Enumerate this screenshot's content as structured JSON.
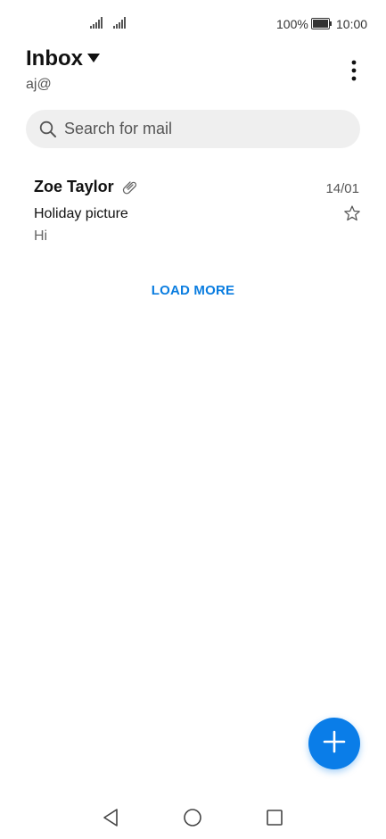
{
  "status_bar": {
    "battery": "100%",
    "time": "10:00",
    "icons": [
      "signal-icon",
      "signal-icon",
      "battery-icon"
    ]
  },
  "header": {
    "title": "Inbox",
    "account": "aj@",
    "icons": [
      "dropdown-icon",
      "more-options-icon"
    ]
  },
  "search": {
    "placeholder": "Search for mail",
    "value": ""
  },
  "mails": [
    {
      "sender": "Zoe Taylor",
      "date": "14/01",
      "subject": "Holiday picture",
      "preview": "Hi",
      "has_attachment": true,
      "starred": false
    }
  ],
  "load_more_label": "LOAD MORE",
  "fab": {
    "icon": "compose-plus-icon"
  },
  "nav": {
    "icons": [
      "back-icon",
      "home-icon",
      "recents-icon"
    ]
  },
  "colors": {
    "accent": "#0a7de8",
    "link": "#0a7de0",
    "search_bg": "#efefef"
  }
}
